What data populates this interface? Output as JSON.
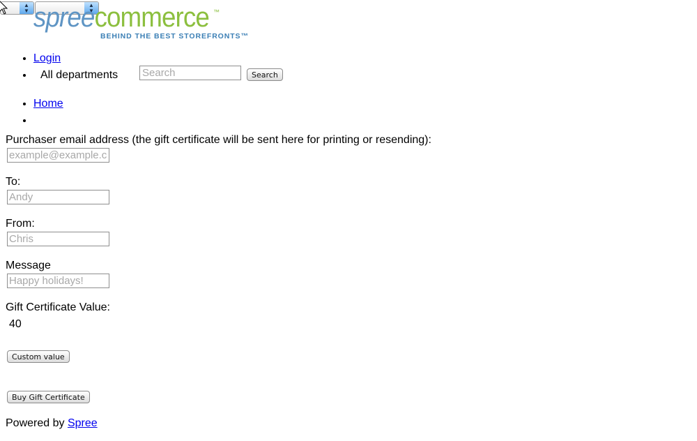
{
  "top_selects": {
    "first": "",
    "second": ""
  },
  "logo": {
    "word_spree": "spree",
    "word_commerce": "commerce",
    "tm": "™",
    "tagline": "BEHIND THE BEST STOREFRONTS™"
  },
  "nav": {
    "login": "Login",
    "departments": "All departments",
    "search_placeholder": "Search",
    "search_button": "Search"
  },
  "breadcrumbs": {
    "home": "Home"
  },
  "form": {
    "email_label": "Purchaser email address (the gift certificate will be sent here for printing or resending):",
    "email_placeholder": "example@example.com",
    "to_label": "To:",
    "to_placeholder": "Andy",
    "from_label": "From:",
    "from_placeholder": "Chris",
    "message_label": "Message",
    "message_placeholder": "Happy holidays!",
    "value_label": "Gift Certificate Value:",
    "value": "40",
    "custom_value_button": "Custom value",
    "buy_button": "Buy Gift Certificate"
  },
  "footer": {
    "powered_by": "Powered by",
    "spree_link": "Spree"
  },
  "colors": {
    "link": "#0000ee",
    "logo_blue": "#5f95c4",
    "logo_green": "#8cbf3f"
  }
}
